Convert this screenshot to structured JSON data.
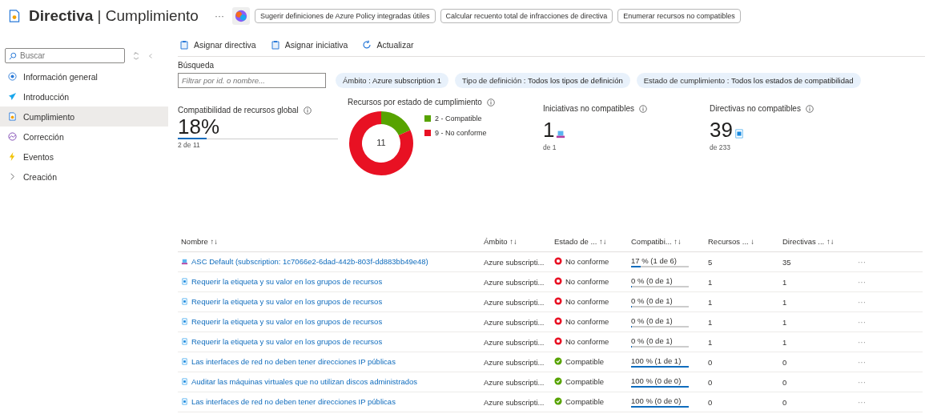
{
  "header": {
    "title_bold": "Directiva",
    "title_sep": "|",
    "title_light": "Cumplimiento",
    "more": "···",
    "copilot_suggestions": [
      "Sugerir definiciones de Azure Policy integradas útiles",
      "Calcular recuento total de infracciones de directiva",
      "Enumerar recursos no compatibles"
    ]
  },
  "sidebar": {
    "search": {
      "placeholder": "Buscar"
    },
    "items": [
      {
        "label": "Información general",
        "selected": false
      },
      {
        "label": "Introducción",
        "selected": false
      },
      {
        "label": "Cumplimiento",
        "selected": true
      },
      {
        "label": "Corrección",
        "selected": false
      },
      {
        "label": "Eventos",
        "selected": false
      },
      {
        "label": "Creación",
        "selected": false
      }
    ]
  },
  "toolbar": [
    {
      "label": "Asignar directiva"
    },
    {
      "label": "Asignar iniciativa"
    },
    {
      "label": "Actualizar"
    }
  ],
  "search": {
    "label": "Búsqueda",
    "placeholder": "Filtrar por id. o nombre..."
  },
  "filters": [
    {
      "name": "Ámbito : ",
      "value": "Azure subscription 1"
    },
    {
      "name": "Tipo de definición : ",
      "value": "Todos los tipos de definición"
    },
    {
      "name": "Estado de cumplimiento : ",
      "value": "Todos los estados de compatibilidad"
    }
  ],
  "overall": {
    "title": "Compatibilidad de recursos global",
    "value": "18%",
    "level": 0.18,
    "sub": "2 de 11"
  },
  "by_state": {
    "title": "Recursos por estado de cumplimiento",
    "center": "11",
    "chart_data": {
      "type": "donut",
      "categories": [
        "2 - Compatible",
        "9 - No conforme"
      ],
      "series": [
        {
          "colors": [
            "#57a300",
            "#e81123"
          ],
          "values": [
            2,
            9
          ]
        }
      ]
    }
  },
  "initiatives": {
    "title": "Iniciativas no compatibles",
    "value": "1",
    "sub": "de 1"
  },
  "policies": {
    "title": "Directivas no compatibles",
    "value": "39",
    "sub": "de 233"
  },
  "table": {
    "columns": [
      "Nombre ↑↓",
      "Ámbito ↑↓",
      "Estado de ... ↑↓",
      "Compatibi... ↑↓",
      "Recursos ... ↓",
      "Directivas ... ↑↓"
    ],
    "more": "···",
    "rows": [
      {
        "kind": "initiative",
        "name": "ASC Default (subscription: 1c7066e2-6dad-442b-803f-dd883bb49e48)",
        "scope": "Azure subscripti...",
        "compliant": false,
        "status_label": "No conforme",
        "compliance": "17 % (1 de 6)",
        "level": 0.17,
        "resources": "5",
        "policies": "35"
      },
      {
        "kind": "policy",
        "name": "Requerir la etiqueta y su valor en los grupos de recursos",
        "scope": "Azure subscripti...",
        "compliant": false,
        "status_label": "No conforme",
        "compliance": "0 % (0 de 1)",
        "level": 0,
        "resources": "1",
        "policies": "1"
      },
      {
        "kind": "policy",
        "name": "Requerir la etiqueta y su valor en los grupos de recursos",
        "scope": "Azure subscripti...",
        "compliant": false,
        "status_label": "No conforme",
        "compliance": "0 % (0 de 1)",
        "level": 0,
        "resources": "1",
        "policies": "1"
      },
      {
        "kind": "policy",
        "name": "Requerir la etiqueta y su valor en los grupos de recursos",
        "scope": "Azure subscripti...",
        "compliant": false,
        "status_label": "No conforme",
        "compliance": "0 % (0 de 1)",
        "level": 0,
        "resources": "1",
        "policies": "1"
      },
      {
        "kind": "policy",
        "name": "Requerir la etiqueta y su valor en los grupos de recursos",
        "scope": "Azure subscripti...",
        "compliant": false,
        "status_label": "No conforme",
        "compliance": "0 % (0 de 1)",
        "level": 0,
        "resources": "1",
        "policies": "1"
      },
      {
        "kind": "policy",
        "name": "Las interfaces de red no deben tener direcciones IP públicas",
        "scope": "Azure subscripti...",
        "compliant": true,
        "status_label": "Compatible",
        "compliance": "100 % (1 de 1)",
        "level": 1,
        "resources": "0",
        "policies": "0"
      },
      {
        "kind": "policy",
        "name": "Auditar las máquinas virtuales que no utilizan discos administrados",
        "scope": "Azure subscripti...",
        "compliant": true,
        "status_label": "Compatible",
        "compliance": "100 % (0 de 0)",
        "level": 1,
        "resources": "0",
        "policies": "0"
      },
      {
        "kind": "policy",
        "name": "Las interfaces de red no deben tener direcciones IP públicas",
        "scope": "Azure subscripti...",
        "compliant": true,
        "status_label": "Compatible",
        "compliance": "100 % (0 de 0)",
        "level": 1,
        "resources": "0",
        "policies": "0"
      }
    ]
  }
}
